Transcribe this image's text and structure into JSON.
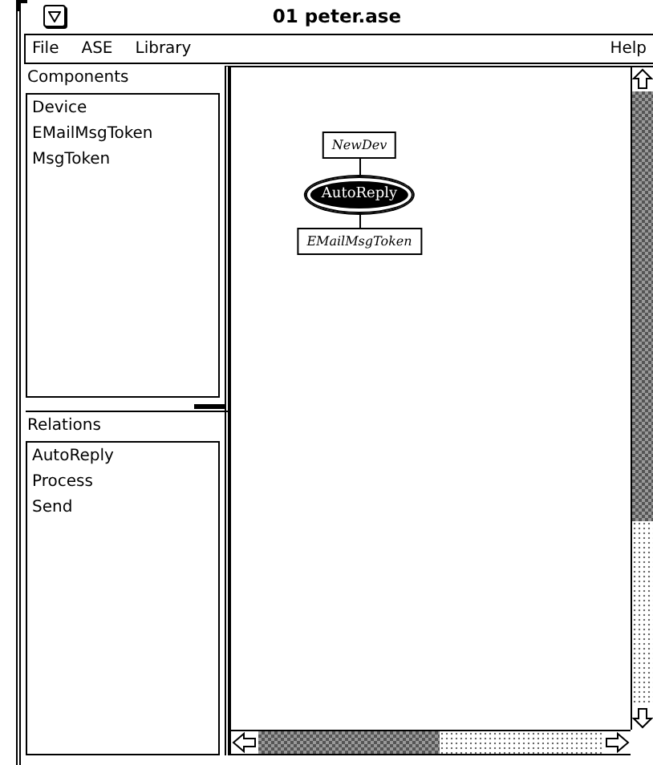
{
  "window": {
    "title": "01 peter.ase"
  },
  "menu": {
    "left": [
      "File",
      "ASE",
      "Library"
    ],
    "right": [
      "Help"
    ]
  },
  "components": {
    "title": "Components",
    "items": [
      "Device",
      "EMailMsgToken",
      "MsgToken"
    ]
  },
  "relations": {
    "title": "Relations",
    "items": [
      "AutoReply",
      "Process",
      "Send"
    ]
  },
  "diagram": {
    "nodes": [
      {
        "label": "NewDev",
        "kind": "entity",
        "selected": false
      },
      {
        "label": "AutoReply",
        "kind": "relation",
        "selected": true
      },
      {
        "label": "EMailMsgToken",
        "kind": "entity",
        "selected": false
      }
    ]
  }
}
